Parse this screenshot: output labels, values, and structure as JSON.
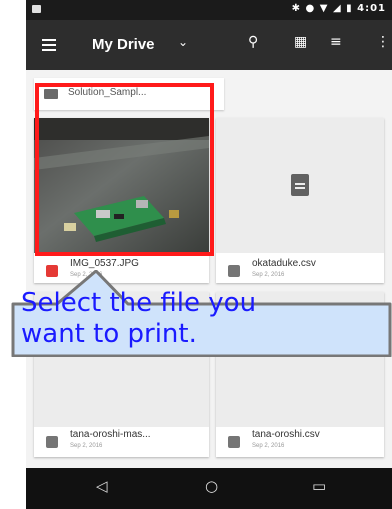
{
  "status_bar": {
    "time": "4:01"
  },
  "toolbar": {
    "title": "My Drive"
  },
  "folder": {
    "name": "Solution_Sampl..."
  },
  "files": [
    {
      "name": "IMG_0537.JPG",
      "date": "Sep 2, 2016",
      "type": "image"
    },
    {
      "name": "okataduke.csv",
      "date": "Sep 2, 2016",
      "type": "csv"
    },
    {
      "name": "tana-oroshi-mas...",
      "date": "Sep 2, 2016",
      "type": "csv"
    },
    {
      "name": "tana-oroshi.csv",
      "date": "Sep 2, 2016",
      "type": "csv"
    }
  ],
  "callout": {
    "line1": "Select the file you",
    "line2": "want to print."
  },
  "colors": {
    "highlight": "#ff1a1a",
    "callout_text": "#1a1aff",
    "callout_bg": "#cfe3fb"
  }
}
